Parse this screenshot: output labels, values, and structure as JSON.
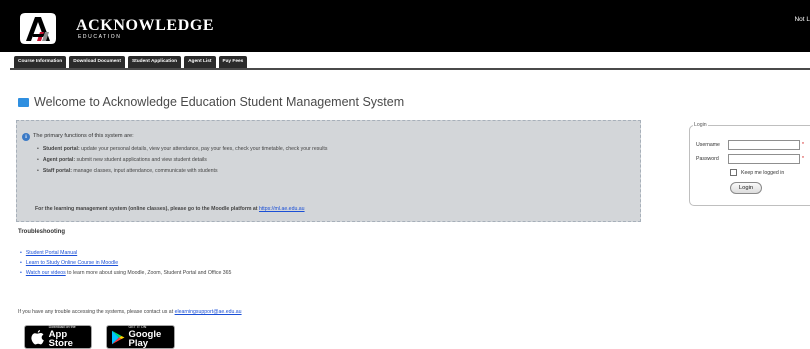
{
  "header": {
    "brand_name": "ACKNOWLEDGE",
    "brand_sub": "EDUCATION",
    "login_status": "Not L"
  },
  "nav": {
    "tabs": [
      {
        "label": "Course Information"
      },
      {
        "label": "Download Document"
      },
      {
        "label": "Student Application"
      },
      {
        "label": "Agent List"
      },
      {
        "label": "Pay Fees"
      }
    ]
  },
  "page": {
    "title": "Welcome to Acknowledge Education Student Management System"
  },
  "info": {
    "heading": "The primary functions of this system are:",
    "portals": [
      {
        "name": "Student portal:",
        "desc": " update your personal details, view your attendance, pay your fees, check your timetable, check your results"
      },
      {
        "name": "Agent portal:",
        "desc": " submit new student applications and view student details"
      },
      {
        "name": "Staff portal:",
        "desc": " manage classes, input attendance, communicate with students"
      }
    ],
    "moodle_text": "For the learning management system (online classes), please go to the Moodle platform at ",
    "moodle_link": "https://ml.ae.edu.au"
  },
  "troubleshooting": {
    "title": "Troubleshooting",
    "items": [
      {
        "link": "Student Portal Manual",
        "text": ""
      },
      {
        "link": "Learn to Study Online Course in Moodle",
        "text": ""
      },
      {
        "link": "Watch our videos",
        "text": " to learn more about using Moodle, Zoom, Student Portal and Office 365"
      }
    ],
    "contact_text": "If you have any trouble accessing the systems, please contact us at ",
    "contact_email": "elearningsupport@ae.edu.au"
  },
  "badges": {
    "appstore_small": "Download on the",
    "appstore_big": "App Store",
    "gplay_small": "GET IT ON",
    "gplay_big": "Google Play"
  },
  "login": {
    "legend": "Login",
    "username_label": "Username",
    "username_value": "",
    "password_label": "Password",
    "password_value": "",
    "required_mark": "*",
    "remember_label": "Keep me logged in",
    "remember_checked": false,
    "button_label": "Login"
  },
  "colors": {
    "header_bg": "#000000",
    "nav_tab_bg": "#2b2b2b",
    "title_icon": "#2f8fe0",
    "info_panel_bg": "#d3d6d9",
    "info_icon": "#3b7ac6",
    "link": "#1a4fd6"
  },
  "icons": {
    "logo": "acknowledge-a-logo",
    "title": "monitor-icon",
    "info": "info-icon",
    "appstore": "apple-icon",
    "gplay": "google-play-icon"
  }
}
